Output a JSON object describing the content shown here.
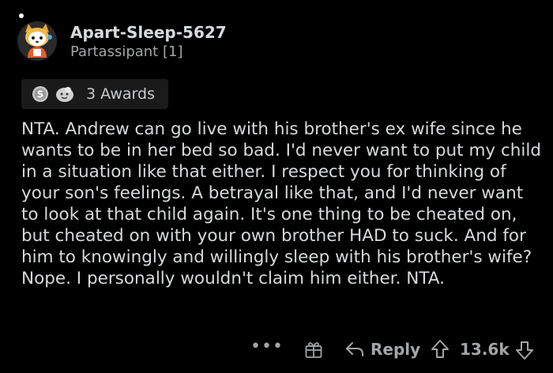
{
  "comment": {
    "author": {
      "username": "Apart-Sleep-5627",
      "flair": "Partassipant [1]",
      "avatar_icon": "snoo-avatar-icon",
      "online_indicator": "online-dot-icon"
    },
    "awards": {
      "icons": [
        "silver-award-icon",
        "wholesome-award-icon"
      ],
      "label": "3 Awards"
    },
    "body": "NTA. Andrew can go live with his brother's ex wife since he wants to be in her bed so bad. I'd never want to put my child in a situation like that either. I respect you for thinking of your son's feelings. A betrayal like that, and I'd never want to look at that child again. It's one thing to be cheated on, but cheated on with your own brother HAD to suck. And for him to knowingly and willingly sleep with his brother's wife? Nope. I personally wouldn't claim him either. NTA.",
    "actions": {
      "more_label": "•••",
      "give_award_icon": "gift-icon",
      "reply_label": "Reply",
      "upvote_icon": "upvote-arrow-icon",
      "score": "13.6k",
      "downvote_icon": "downvote-arrow-icon"
    }
  },
  "colors": {
    "background": "#000000",
    "text": "#d7dadc",
    "muted": "#a3a5a7",
    "award_bg": "#1a1a1b"
  }
}
